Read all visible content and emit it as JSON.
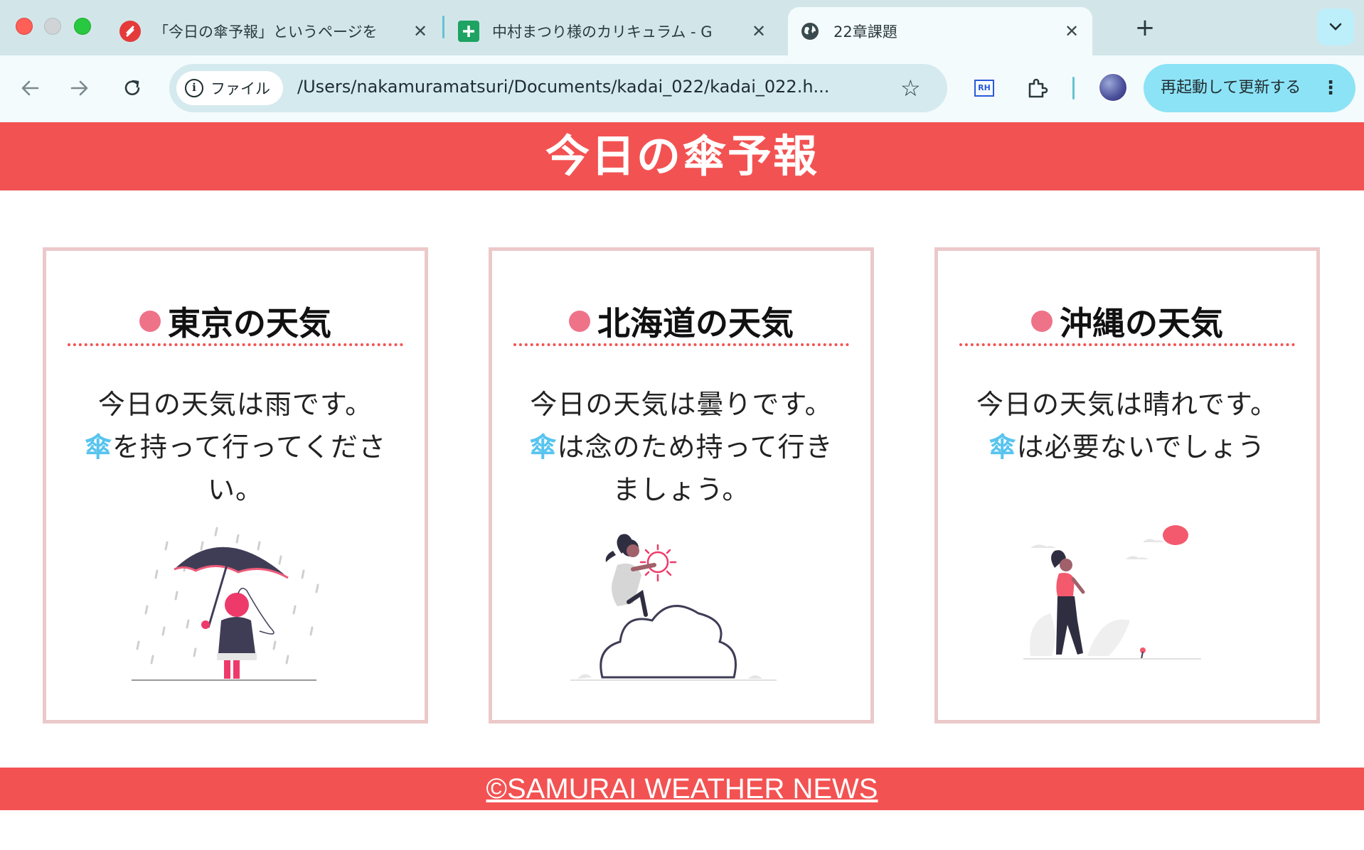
{
  "browser": {
    "tabs": [
      {
        "title": "「今日の傘予報」というページを",
        "favicon": "red-s-logo-icon",
        "active": false
      },
      {
        "title": "中村まつり様のカリキュラム - G",
        "favicon": "google-sheets-icon",
        "active": false
      },
      {
        "title": "22章課題",
        "favicon": "globe-icon",
        "active": true
      }
    ],
    "site_chip_label": "ファイル",
    "url": "/Users/nakamuramatsuri/Documents/kadai_022/kadai_022.h...",
    "update_button_label": "再起動して更新する",
    "extension_rh_label": "RH",
    "new_tab_symbol": "+",
    "tab_close_symbol": "✕",
    "tab_menu_symbol": "⌄"
  },
  "page": {
    "header_title": "今日の傘予報",
    "cards": [
      {
        "title": "東京の天気",
        "line1": "今日の天気は雨です。",
        "kasa": "傘",
        "line2": "を持って行ってください。",
        "illustration": "woman-with-umbrella-in-rain"
      },
      {
        "title": "北海道の天気",
        "line1": "今日の天気は曇りです。",
        "kasa": "傘",
        "line2": "は念のため持って行きましょう。",
        "illustration": "woman-sitting-on-cloud"
      },
      {
        "title": "沖縄の天気",
        "line1": "今日の天気は晴れです。",
        "kasa": "傘",
        "line2": "は必要ないでしょう",
        "illustration": "woman-walking-in-sun"
      }
    ],
    "footer_link": "©SAMURAI WEATHER NEWS"
  },
  "colors": {
    "accent_red": "#f35252",
    "card_border": "#ecc9c9",
    "title_dot": "#ee7389",
    "kasa_blue": "#57c4ef",
    "tab_bar": "#d2e6ea",
    "update_button": "#8de3f6"
  }
}
